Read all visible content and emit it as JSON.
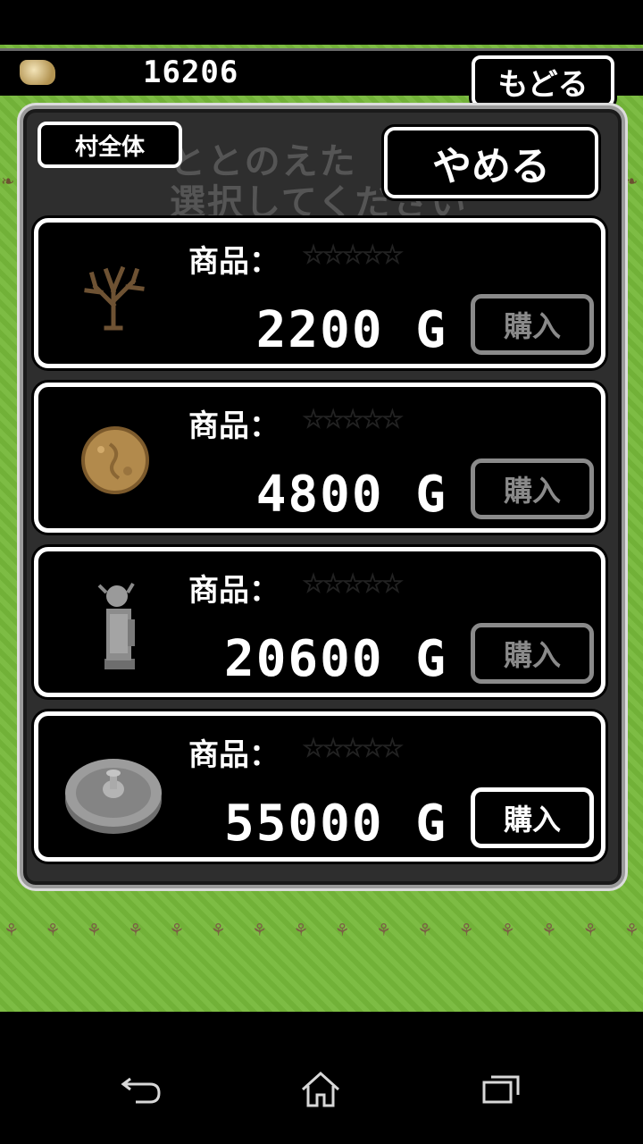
{
  "hud": {
    "gold": "16206",
    "back_label": "もどる",
    "coin_icon": "gold-pile-icon"
  },
  "panel": {
    "scope_label": "村全体",
    "faded_line1": "ととのえた",
    "faded_line2": "選択してください",
    "cancel_label": "やめる"
  },
  "items": [
    {
      "label": "商品：",
      "rating": "☆☆☆☆☆",
      "price": "2200 G",
      "buy_label": "購入",
      "icon": "bare-tree-icon",
      "buy_enabled": false
    },
    {
      "label": "商品：",
      "rating": "☆☆☆☆☆",
      "price": "4800 G",
      "buy_label": "購入",
      "icon": "boulder-icon",
      "buy_enabled": false
    },
    {
      "label": "商品：",
      "rating": "☆☆☆☆☆",
      "price": "20600 G",
      "buy_label": "購入",
      "icon": "goblin-statue-icon",
      "buy_enabled": false
    },
    {
      "label": "商品：",
      "rating": "☆☆☆☆☆",
      "price": "55000 G",
      "buy_label": "購入",
      "icon": "stone-fountain-icon",
      "buy_enabled": true
    }
  ],
  "nav": {
    "back_icon": "back-arrow-icon",
    "home_icon": "home-icon",
    "recents_icon": "recent-apps-icon"
  },
  "colors": {
    "grass": "#76b83a",
    "star": "#f5f50a",
    "panel": "#2e2e2e"
  }
}
